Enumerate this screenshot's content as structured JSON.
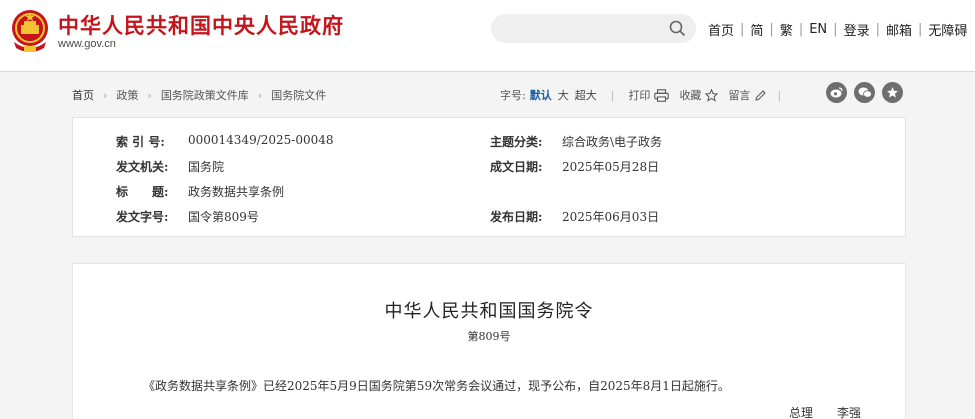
{
  "header": {
    "site_title": "中华人民共和国中央人民政府",
    "site_domain": "www.gov.cn",
    "nav": [
      "首页",
      "简",
      "繁",
      "EN",
      "登录",
      "邮箱",
      "无障碍"
    ],
    "search_placeholder": ""
  },
  "breadcrumb": [
    "首页",
    "政策",
    "国务院政策文件库",
    "国务院文件"
  ],
  "font_size": {
    "label": "字号:",
    "options": [
      "默认",
      "大",
      "超大"
    ],
    "selected": "默认"
  },
  "tools": {
    "print": "打印",
    "favorite": "收藏",
    "comment": "留言"
  },
  "social_icons": [
    "weibo-icon",
    "wechat-icon",
    "star-icon"
  ],
  "meta": {
    "index_label": "索 引 号:",
    "index_value": "000014349/2025-00048",
    "category_label": "主题分类:",
    "category_value": "综合政务\\电子政务",
    "issuer_label": "发文机关:",
    "issuer_value": "国务院",
    "date_written_label": "成文日期:",
    "date_written_value": "2025年05月28日",
    "title_label": "标　　题:",
    "title_value": "政务数据共享条例",
    "doc_no_label": "发文字号:",
    "doc_no_value": "国令第809号",
    "publish_label": "发布日期:",
    "publish_value": "2025年06月03日"
  },
  "document": {
    "title": "中华人民共和国国务院令",
    "number": "第809号",
    "paragraph": "《政务数据共享条例》已经2025年5月9日国务院第59次常务会议通过，现予公布，自2025年8月1日起施行。",
    "sign_role": "总理",
    "sign_name": "李强"
  },
  "colors": {
    "brand_red": "#c4151c",
    "link_blue": "#1c5fa8",
    "background": "#f4f4f4"
  }
}
